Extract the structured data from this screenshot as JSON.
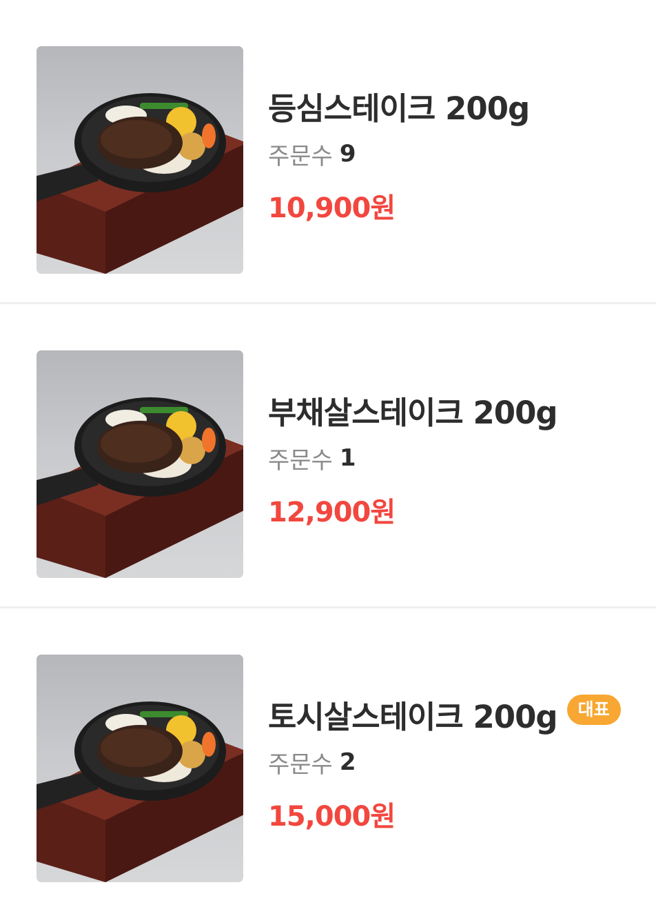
{
  "items": [
    {
      "name": "등심스테이크 200g",
      "orders_label": "주문수",
      "orders_count": "9",
      "price": "10,900원",
      "badge": ""
    },
    {
      "name": "부채살스테이크 200g",
      "orders_label": "주문수",
      "orders_count": "1",
      "price": "12,900원",
      "badge": ""
    },
    {
      "name": "토시살스테이크 200g",
      "orders_label": "주문수",
      "orders_count": "2",
      "price": "15,000원",
      "badge": "대표"
    }
  ],
  "colors": {
    "price": "#f2473f",
    "badge": "#f7a732",
    "title": "#2d2d2d",
    "label": "#8a8a8a",
    "divider": "#efefef"
  }
}
